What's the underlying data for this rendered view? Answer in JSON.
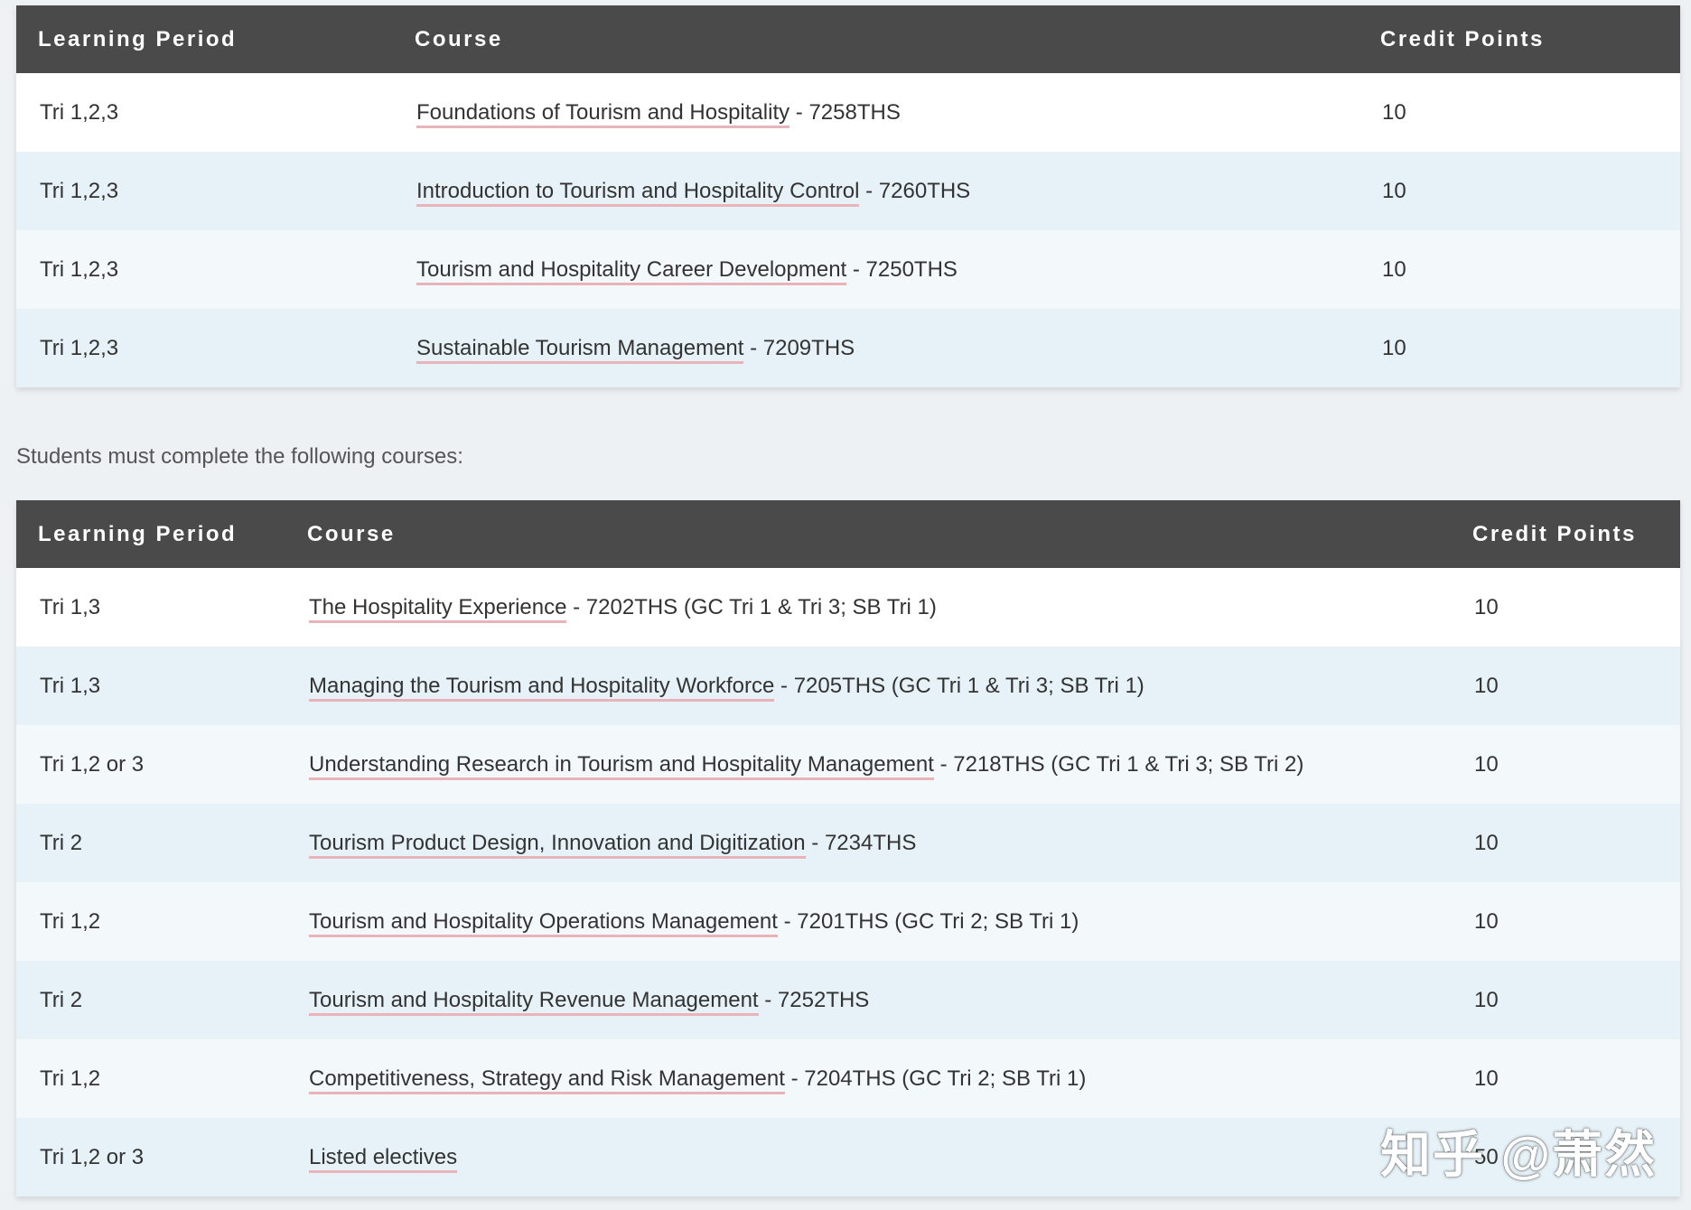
{
  "table1": {
    "headers": [
      "Learning Period",
      "Course",
      "Credit Points"
    ],
    "rows": [
      {
        "period": "Tri 1,2,3",
        "course_name": "Foundations of Tourism and Hospitality",
        "course_suffix": " - 7258THS",
        "credits": "10"
      },
      {
        "period": "Tri 1,2,3",
        "course_name": "Introduction to Tourism and Hospitality Control",
        "course_suffix": " - 7260THS",
        "credits": "10"
      },
      {
        "period": "Tri 1,2,3",
        "course_name": "Tourism and Hospitality Career Development",
        "course_suffix": " - 7250THS",
        "credits": "10"
      },
      {
        "period": "Tri 1,2,3",
        "course_name": "Sustainable Tourism Management",
        "course_suffix": " - 7209THS",
        "credits": "10"
      }
    ]
  },
  "intro_text": "Students must complete the following courses:",
  "table2": {
    "headers": [
      "Learning Period",
      "Course",
      "Credit Points"
    ],
    "rows": [
      {
        "period": "Tri 1,3",
        "course_name": "The Hospitality Experience",
        "course_suffix": " - 7202THS (GC Tri 1 & Tri 3; SB Tri 1)",
        "credits": "10"
      },
      {
        "period": "Tri 1,3",
        "course_name": "Managing the Tourism and Hospitality Workforce",
        "course_suffix": " - 7205THS (GC Tri 1 & Tri 3; SB Tri 1)",
        "credits": "10"
      },
      {
        "period": "Tri 1,2 or 3",
        "course_name": "Understanding Research in Tourism and Hospitality Management",
        "course_suffix": " - 7218THS (GC Tri 1 & Tri 3; SB Tri 2)",
        "credits": "10"
      },
      {
        "period": "Tri 2",
        "course_name": "Tourism Product Design, Innovation and Digitization",
        "course_suffix": " - 7234THS",
        "credits": "10"
      },
      {
        "period": "Tri 1,2",
        "course_name": "Tourism and Hospitality Operations Management",
        "course_suffix": " - 7201THS (GC Tri 2; SB Tri 1)",
        "credits": "10"
      },
      {
        "period": "Tri 2",
        "course_name": "Tourism and Hospitality Revenue Management",
        "course_suffix": " - 7252THS",
        "credits": "10"
      },
      {
        "period": "Tri 1,2",
        "course_name": "Competitiveness, Strategy and Risk Management",
        "course_suffix": " - 7204THS (GC Tri 2; SB Tri 1)",
        "credits": "10"
      },
      {
        "period": "Tri 1,2 or 3",
        "course_name": "Listed electives",
        "course_suffix": "",
        "credits": "50"
      }
    ]
  },
  "watermark": "知乎 @萧然",
  "colors": {
    "header_bg": "#4a4a4a",
    "row_light": "#f3f8fb",
    "row_blue": "#e6f2f7",
    "link_underline": "#e9b3ba",
    "page_bg": "#edf1f4"
  }
}
